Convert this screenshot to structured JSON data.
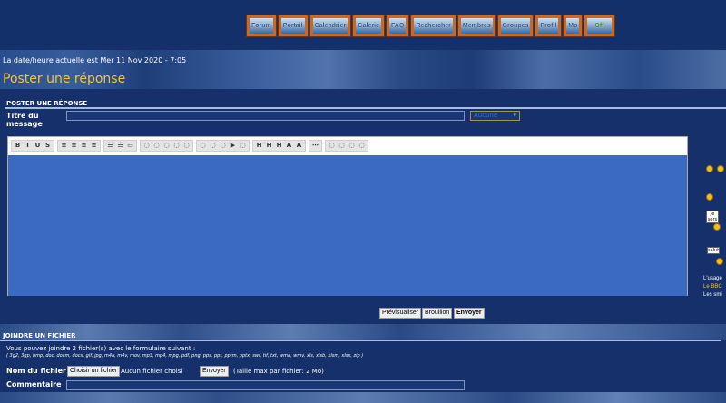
{
  "nav": [
    "Forum",
    "Portail",
    "Calendrier",
    "Galerie",
    "FAQ",
    "Rechercher",
    "Membres",
    "Groupes",
    "Profil",
    "Mp",
    "Off"
  ],
  "date_text": "La date/heure actuelle est Mer 11 Nov 2020 - 7:05",
  "page_title": "Poster une réponse",
  "section_title": "POSTER UNE RÉPONSE",
  "subject": {
    "label": "Titre du message",
    "value": "",
    "icon_select": "Aucune"
  },
  "toolbar_groups": [
    [
      "B",
      "I",
      "U",
      "S"
    ],
    [
      "≡",
      "≡",
      "≡",
      "≡"
    ],
    [
      "☰",
      "☰",
      "▭"
    ],
    [
      "◌",
      "◌",
      "◌",
      "◌",
      "◌"
    ],
    [
      "◌",
      "◌",
      "◌",
      "▶",
      "◌"
    ],
    [
      "H",
      "H",
      "H",
      "A",
      "A"
    ],
    [
      "⋯"
    ],
    [
      "◌",
      "◌",
      "◌",
      "◌"
    ]
  ],
  "smilies": {
    "sign1": "Je sors",
    "sign2": "salut"
  },
  "sidebar_text": [
    "L'usage",
    "Le BBC",
    "Les smi"
  ],
  "buttons": {
    "preview": "Prévisualiser",
    "draft": "Brouillon",
    "send": "Envoyer"
  },
  "attach": {
    "title": "JOINDRE UN FICHIER",
    "intro": "Vous pouvez joindre 2 fichier(s) avec le formulaire suivant :",
    "types": "( 3g2, 3gp, bmp, doc, docm, docx, gif, jpg, m4a, m4v, mov, mp3, mp4, mpg, pdf, png, pps, ppt, pptm, pptx, swf, tif, txt, wma, wmv, xls, xlsb, xlsm, xlsx, zip )",
    "file_label": "Nom du fichier",
    "choose": "Choisir un fichier",
    "no_file": "Aucun fichier choisi",
    "upload": "Envoyer",
    "max": "(Taille max par fichier: 2 Mo)",
    "comment_label": "Commentaire",
    "comment_value": ""
  }
}
